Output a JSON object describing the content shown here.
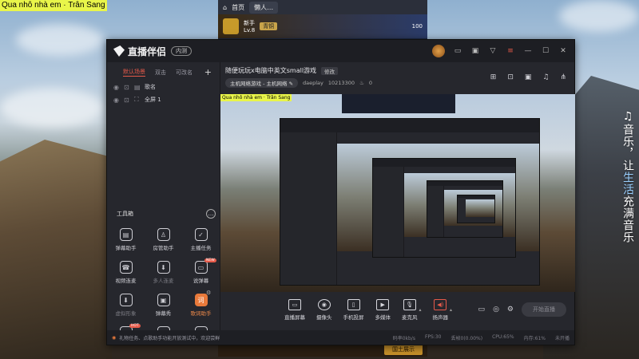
{
  "desktop": {
    "caption": "Qua nhô nhà em · Trân Sang",
    "slogan_pre": "♫音乐，让",
    "slogan_hl": "生活",
    "slogan_post": "充满音乐"
  },
  "background_app": {
    "tabs": [
      "首页",
      "懒人…"
    ],
    "player_name": "新手",
    "player_level": "Lv.8",
    "chip_label": "青铜",
    "score": "100",
    "bottom_button": "国土展示"
  },
  "app": {
    "name": "直播伴侣",
    "version_badge": "内测"
  },
  "scene_panel": {
    "tabs": [
      "默认场景",
      "双击",
      "可改名"
    ],
    "active_tab": 0,
    "add": "+",
    "sources": [
      {
        "label": "歌名"
      },
      {
        "label": "全屏 1"
      }
    ]
  },
  "toolbox": {
    "title": "工具箱",
    "more": "…",
    "tools": [
      {
        "label": "弹幕助手",
        "glyph": "▤",
        "style": ""
      },
      {
        "label": "房管助手",
        "glyph": "♙",
        "style": ""
      },
      {
        "label": "主播任务",
        "glyph": "✓",
        "style": ""
      },
      {
        "label": "视频连麦",
        "glyph": "☎",
        "style": ""
      },
      {
        "label": "多人连麦",
        "glyph": "⬇",
        "style": "dim"
      },
      {
        "label": "说弹幕",
        "glyph": "▭",
        "style": "",
        "badge": "NEW"
      },
      {
        "label": "虚拟形象",
        "glyph": "⬇",
        "style": "dim"
      },
      {
        "label": "弹幕秀",
        "glyph": "▣",
        "style": ""
      },
      {
        "label": "歌词助手",
        "glyph": "词",
        "style": "orange",
        "gear": "⚙"
      },
      {
        "label": "",
        "glyph": "✚",
        "style": "",
        "badge": "HOT"
      },
      {
        "label": "",
        "glyph": "⬇",
        "style": ""
      },
      {
        "label": "",
        "glyph": "⚇",
        "style": ""
      }
    ]
  },
  "room": {
    "title": "随便玩玩x电脑中英文small游戏",
    "edit_label": "修改",
    "category": "主机网络游戏 - 主机网络",
    "user": "daeplay",
    "room_id": "10213300",
    "viewers": "0"
  },
  "preview": {
    "caption": "Qua nhô nhà em · Trân Sang"
  },
  "controls": {
    "items": [
      {
        "label": "直播屏幕",
        "glyph": "▭",
        "shape": ""
      },
      {
        "label": "摄像头",
        "glyph": "◉",
        "shape": "round"
      },
      {
        "label": "手机投屏",
        "glyph": "▯",
        "shape": ""
      },
      {
        "label": "多媒体",
        "glyph": "▶",
        "shape": ""
      },
      {
        "label": "麦克风",
        "glyph": "🎙",
        "shape": "",
        "caret": true
      },
      {
        "label": "扬声器",
        "glyph": "◀)",
        "shape": "red",
        "caret": true
      }
    ],
    "live_button": "开始直播"
  },
  "status_bar": {
    "notice": "礼物任务、点歌助手功能开放测试中，欢迎尝鲜",
    "bitrate": "码率0kb/s",
    "fps": "FPS:30",
    "dropped": "丢帧0(0.00%)",
    "cpu": "CPU:65%",
    "mem": "内存:61%",
    "state": "未开播"
  },
  "colors": {
    "accent": "#e65a4a",
    "orange": "#e97a3b",
    "caption_bg": "#e9f54a"
  }
}
